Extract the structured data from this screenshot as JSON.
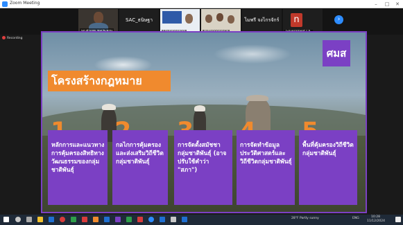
{
  "window": {
    "title": "Zoom Meeting",
    "minimize": "–",
    "maximize": "□",
    "close": "✕"
  },
  "gallery": {
    "tiles": [
      {
        "name": "นก ตัวแทน ชลประทาน",
        "display": ""
      },
      {
        "name": "",
        "display": "SAC_ธนิษฐา"
      },
      {
        "name": "Chulalongkorn",
        "display": ""
      },
      {
        "name": "Anthropological",
        "display": ""
      },
      {
        "name": "",
        "display": "ไมพรี จงไกรจักร์"
      },
      {
        "name": "Government Ch.",
        "display": ""
      }
    ],
    "letter_avatar": "n",
    "next_icon": "next-page-icon"
  },
  "recording": {
    "label": "Recording"
  },
  "slide": {
    "logo_text": "ศมส",
    "heading": "โครงสร้างกฎหมาย",
    "items": [
      {
        "number": "1",
        "text": "หลักการและแนวทางการคุ้มครองสิทธิทางวัฒนธรรมของกลุ่มชาติพันธุ์"
      },
      {
        "number": "2",
        "text": "กลไกการคุ้มครองและส่งเสริมวิถีชีวิตกลุ่มชาติพันธุ์"
      },
      {
        "number": "3",
        "text": "การจัดตั้งสมัชชากลุ่มชาติพันธุ์ (อาจปรับใช้คำว่า \"สภา\")"
      },
      {
        "number": "4",
        "text": "การจัดทำข้อมูลประวัติศาสตร์และวิถีชีวิตกลุ่มชาติพันธุ์"
      },
      {
        "number": "5",
        "text": "พื้นที่คุ้มครองวิถีชีวิตกลุ่มชาติพันธุ์"
      }
    ]
  },
  "taskbar": {
    "weather": "28°F Partly sunny",
    "time": "10:28",
    "date": "11/12/2024",
    "lang": "ENG",
    "colors": {
      "start": "#ffffff",
      "zoom": "#2d8cff",
      "orange": "#f08a2e",
      "red": "#d83b3b",
      "green": "#2e9e4a",
      "purple": "#7b40c4",
      "yellow": "#f2c12e",
      "blue": "#1f6fd1"
    }
  },
  "theme": {
    "slide_purple": "#7b40c4",
    "accent_orange": "#f08a2e",
    "zoom_blue": "#2d8cff"
  }
}
